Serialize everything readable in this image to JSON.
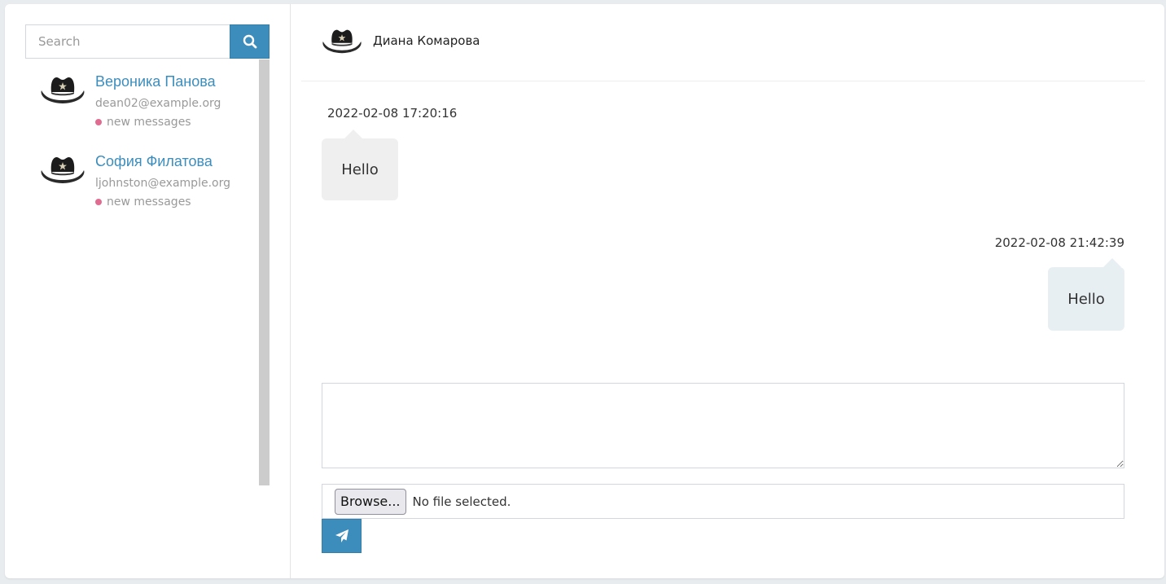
{
  "search": {
    "placeholder": "Search",
    "button_icon": "search-icon"
  },
  "contacts": [
    {
      "name": "Вероника Панова",
      "email": "dean02@example.org",
      "status": "new messages",
      "avatar_icon": "cowboy-hat-icon"
    },
    {
      "name": "София Филатова",
      "email": "ljohnston@example.org",
      "status": "new messages",
      "avatar_icon": "cowboy-hat-icon"
    }
  ],
  "chat": {
    "partner_name": "Диана Комарова",
    "partner_avatar_icon": "cowboy-hat-icon",
    "messages": [
      {
        "direction": "incoming",
        "timestamp": "2022-02-08 17:20:16",
        "text": "Hello"
      },
      {
        "direction": "outgoing",
        "timestamp": "2022-02-08 21:42:39",
        "text": "Hello"
      }
    ]
  },
  "composer": {
    "message_value": "",
    "browse_label": "Browse...",
    "file_status": "No file selected.",
    "send_icon": "paper-plane-icon"
  },
  "colors": {
    "accent": "#3c8dbc",
    "contact_name": "#3c8dbc",
    "status_dot": "#e06c92",
    "incoming_bubble": "#efefef",
    "outgoing_bubble": "#e8eff3"
  }
}
